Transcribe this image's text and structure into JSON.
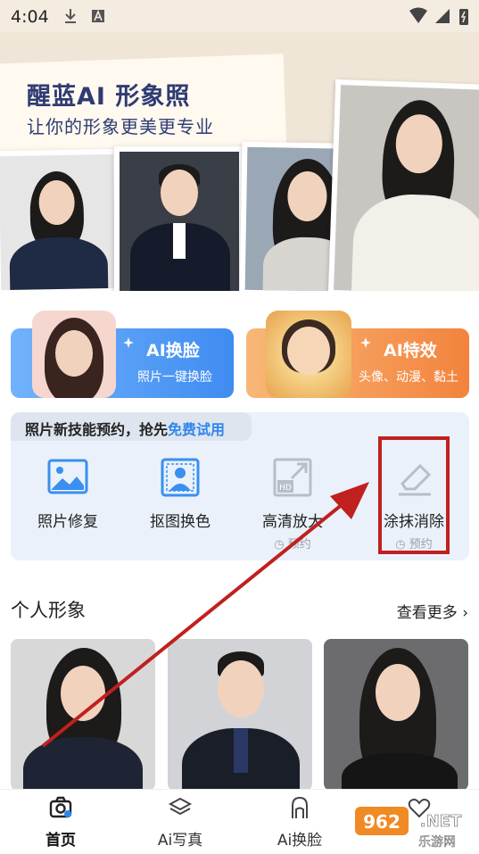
{
  "status_bar": {
    "time": "4:04"
  },
  "banner": {
    "title": "醒蓝AI 形象照",
    "subtitle": "让你的形象更美更专业"
  },
  "features": [
    {
      "label": "AI换脸",
      "desc": "照片一键换脸",
      "color": "#4f9bf5"
    },
    {
      "label": "AI特效",
      "desc": "头像、动漫、黏土",
      "color": "#f79b4f"
    }
  ],
  "skills": {
    "tag_prefix": "照片新技能预约，抢先",
    "tag_highlight": "免费试用",
    "tools": [
      {
        "name": "照片修复",
        "status": "",
        "icon": "image-icon"
      },
      {
        "name": "抠图换色",
        "status": "",
        "icon": "person-cutout-icon"
      },
      {
        "name": "高清放大",
        "status": "预约",
        "icon": "hd-expand-icon"
      },
      {
        "name": "涂抹消除",
        "status": "预约",
        "icon": "eraser-icon"
      }
    ]
  },
  "section": {
    "title": "个人形象",
    "more": "查看更多"
  },
  "nav": [
    {
      "label": "首页",
      "icon": "camera-icon",
      "active": true
    },
    {
      "label": "Ai写真",
      "icon": "layers-icon",
      "active": false
    },
    {
      "label": "Ai换脸",
      "icon": "face-icon",
      "active": false
    },
    {
      "label": "",
      "icon": "heart-icon",
      "active": false
    }
  ],
  "watermark": {
    "text_top": "962.NET",
    "text_bottom": "乐游网"
  },
  "colors": {
    "accent": "#2f86ef",
    "annotation": "#c0201e"
  }
}
